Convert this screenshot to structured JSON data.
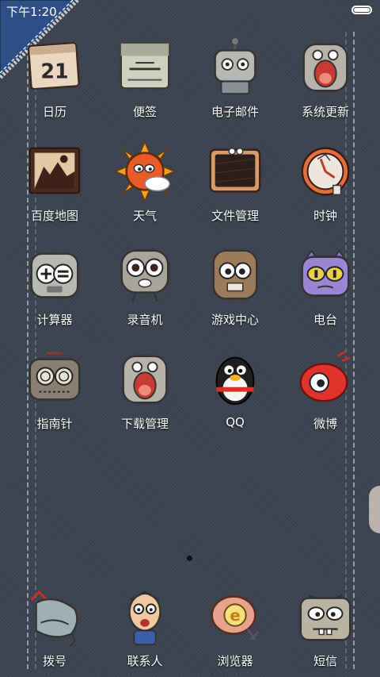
{
  "status": {
    "time": "下午1:20"
  },
  "apps": [
    {
      "label": "日历",
      "icon": "calendar-icon",
      "day": "21"
    },
    {
      "label": "便签",
      "icon": "notes-icon"
    },
    {
      "label": "电子邮件",
      "icon": "email-icon"
    },
    {
      "label": "系统更新",
      "icon": "system-update-icon"
    },
    {
      "label": "百度地图",
      "icon": "baidu-map-icon"
    },
    {
      "label": "天气",
      "icon": "weather-icon"
    },
    {
      "label": "文件管理",
      "icon": "file-manager-icon"
    },
    {
      "label": "时钟",
      "icon": "clock-icon"
    },
    {
      "label": "计算器",
      "icon": "calculator-icon"
    },
    {
      "label": "录音机",
      "icon": "recorder-icon"
    },
    {
      "label": "游戏中心",
      "icon": "game-center-icon"
    },
    {
      "label": "电台",
      "icon": "radio-icon"
    },
    {
      "label": "指南针",
      "icon": "compass-icon"
    },
    {
      "label": "下载管理",
      "icon": "download-manager-icon"
    },
    {
      "label": "QQ",
      "icon": "qq-icon"
    },
    {
      "label": "微博",
      "icon": "weibo-icon"
    }
  ],
  "dock": [
    {
      "label": "拨号",
      "icon": "phone-icon"
    },
    {
      "label": "联系人",
      "icon": "contacts-icon"
    },
    {
      "label": "浏览器",
      "icon": "browser-icon",
      "glyph": "e"
    },
    {
      "label": "短信",
      "icon": "messages-icon"
    }
  ],
  "page_indicator": {
    "current": 1
  }
}
